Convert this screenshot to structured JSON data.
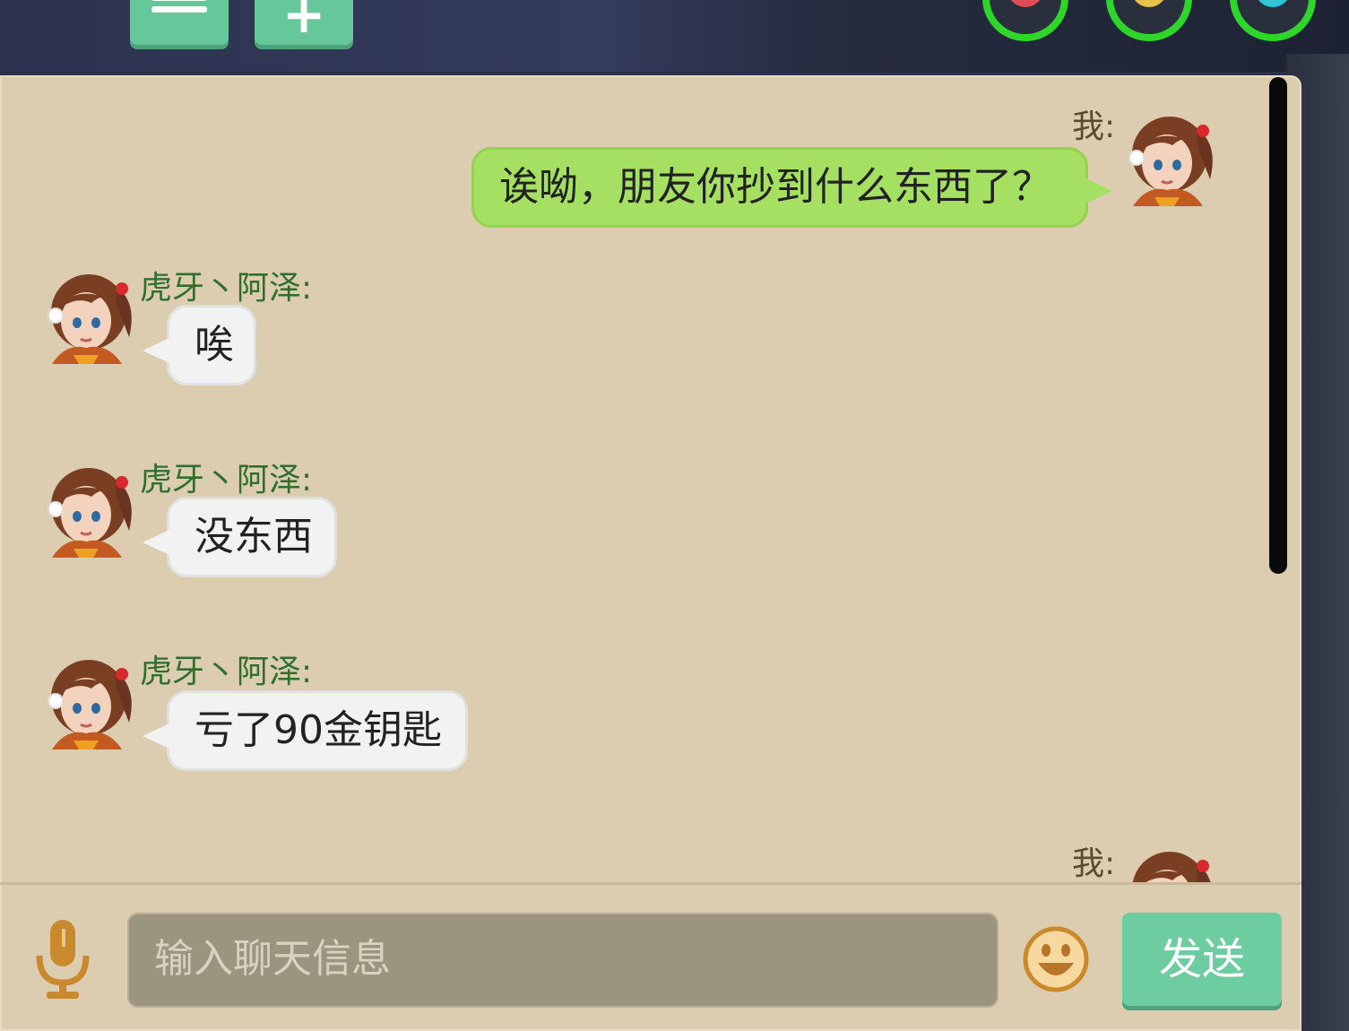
{
  "top_bar": {
    "buttons": [
      {
        "icon": "list-icon"
      },
      {
        "icon": "plus-icon",
        "glyph": "+"
      }
    ],
    "status_rings": [
      {
        "icon": "heart-icon",
        "color": "#e24a55"
      },
      {
        "icon": "chat-bubble-icon",
        "color": "#e7c347"
      },
      {
        "icon": "water-drop-icon",
        "color": "#2fc6d6"
      }
    ]
  },
  "chat": {
    "messages": [
      {
        "sender": "我:",
        "text": "诶呦，朋友你抄到什么东西了？",
        "side": "right"
      },
      {
        "sender": "虎牙丶阿泽:",
        "text": "唉",
        "side": "left"
      },
      {
        "sender": "虎牙丶阿泽:",
        "text": "没东西",
        "side": "left"
      },
      {
        "sender": "虎牙丶阿泽:",
        "text": "亏了90金钥匙",
        "side": "left"
      },
      {
        "sender": "我:",
        "text": "",
        "side": "right"
      }
    ]
  },
  "input_bar": {
    "placeholder": "输入聊天信息",
    "send_label": "发送",
    "mic_icon": "microphone-icon",
    "emoji_icon": "smiley-icon"
  },
  "colors": {
    "panel": "#dccdb0",
    "accent_green": "#6dcca0",
    "my_bubble": "#a6e063",
    "other_bubble": "#f2f2f2",
    "sender_name": "#2f6f2c"
  }
}
